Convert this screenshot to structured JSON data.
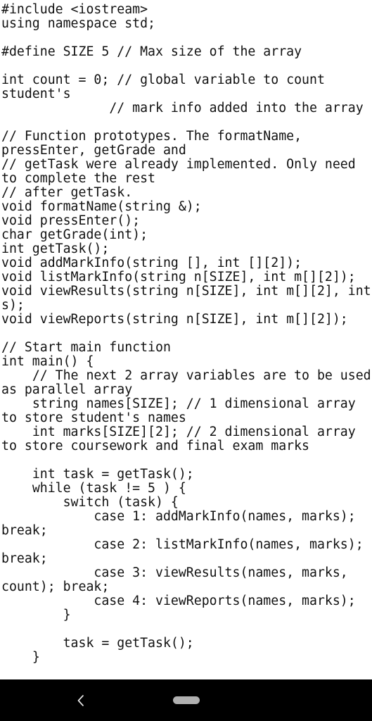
{
  "app": {
    "background_color": "#ffffff",
    "text_color": "#111111"
  },
  "editor": {
    "name": "code-viewer",
    "language": "C++",
    "content": "#include <iostream>\nusing namespace std;\n\n#define SIZE 5 // Max size of the array\n\nint count = 0; // global variable to count student's\n              // mark info added into the array\n\n// Function prototypes. The formatName, pressEnter, getGrade and\n// getTask were already implemented. Only need to complete the rest\n// after getTask.\nvoid formatName(string &);\nvoid pressEnter();\nchar getGrade(int);\nint getTask();\nvoid addMarkInfo(string [], int [][2]);\nvoid listMarkInfo(string n[SIZE], int m[][2]);\nvoid viewResults(string n[SIZE], int m[][2], int s);\nvoid viewReports(string n[SIZE], int m[][2]);\n\n// Start main function\nint main() {\n    // The next 2 array variables are to be used as parallel array\n    string names[SIZE]; // 1 dimensional array to store student's names\n    int marks[SIZE][2]; // 2 dimensional array to store coursework and final exam marks\n\n    int task = getTask();\n    while (task != 5 ) {\n        switch (task) {\n            case 1: addMarkInfo(names, marks); break;\n            case 2: listMarkInfo(names, marks); break;\n            case 3: viewResults(names, marks, count); break;\n            case 4: viewReports(names, marks);\n        }\n\n        task = getTask();\n    }"
  },
  "navbar": {
    "background_color": "#000000",
    "back_label": "Back",
    "back_icon": "chevron-left-icon",
    "home_label": "Home",
    "home_icon": "home-pill-icon",
    "home_color": "#b0b0b0"
  }
}
